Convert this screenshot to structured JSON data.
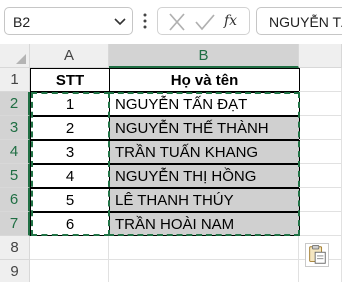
{
  "namebox": {
    "value": "B2"
  },
  "formula": {
    "fx_label": "fx",
    "content": "NGUYỄN TẤN ĐẠT"
  },
  "columns": [
    "A",
    "B"
  ],
  "rows": [
    "1",
    "2",
    "3",
    "4",
    "5",
    "6",
    "7",
    "8",
    "9"
  ],
  "header": {
    "stt": "STT",
    "name": "Họ và tên"
  },
  "data": [
    {
      "stt": "1",
      "name": "NGUYỄN TẤN ĐẠT"
    },
    {
      "stt": "2",
      "name": "NGUYỄN THẾ THÀNH"
    },
    {
      "stt": "3",
      "name": "TRẦN TUẤN KHANG"
    },
    {
      "stt": "4",
      "name": "NGUYỄN THỊ HỒNG"
    },
    {
      "stt": "5",
      "name": "LÊ THANH THÚY"
    },
    {
      "stt": "6",
      "name": "TRẦN HOÀI NAM"
    }
  ],
  "icons": {
    "namebox_dropdown": "chevron-down-icon",
    "more": "vertical-dots-icon",
    "cancel": "close-icon",
    "enter": "checkmark-icon",
    "paste_options": "paste-options-icon"
  },
  "colors": {
    "accent": "#217346",
    "selection_fill": "#d0d0d0"
  }
}
